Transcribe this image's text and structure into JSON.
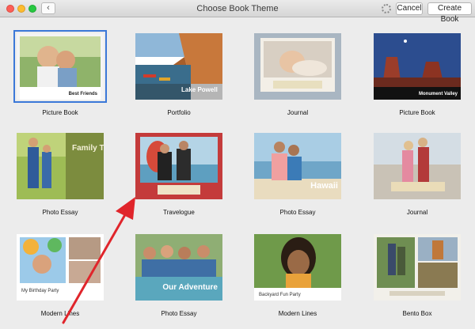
{
  "window": {
    "title": "Choose Book Theme",
    "back_icon": "chevron-left-icon",
    "back_glyph": "‹",
    "cancel_label": "Cancel",
    "create_label": "Create Book"
  },
  "themes": [
    {
      "label": "Picture Book",
      "caption": "Best Friends",
      "selected": true
    },
    {
      "label": "Portfolio",
      "caption": "Lake Powell"
    },
    {
      "label": "Journal",
      "caption": ""
    },
    {
      "label": "Picture Book",
      "caption": "Monument Valley"
    },
    {
      "label": "Photo Essay",
      "caption": "Family Trip"
    },
    {
      "label": "Travelogue",
      "caption": ""
    },
    {
      "label": "Photo Essay",
      "caption": "Hawaii"
    },
    {
      "label": "Journal",
      "caption": ""
    },
    {
      "label": "Modern Lines",
      "caption": "My Birthday Party"
    },
    {
      "label": "Photo Essay",
      "caption": "Our Adventure"
    },
    {
      "label": "Modern Lines",
      "caption": "Backyard Fun Party"
    },
    {
      "label": "Bento Box",
      "caption": ""
    }
  ],
  "annotation": {
    "color": "#e0252b"
  }
}
